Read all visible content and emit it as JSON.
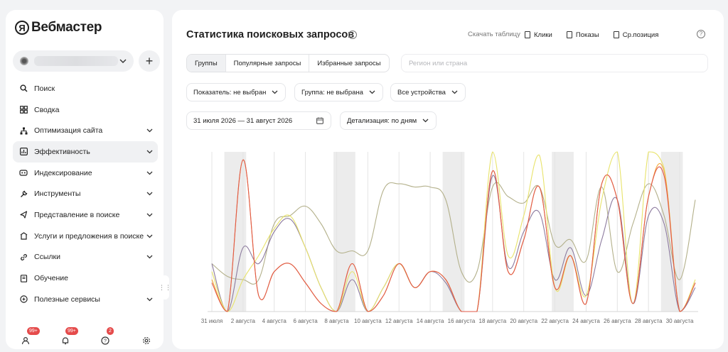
{
  "sidebar": {
    "logo_letter": "Я",
    "logo_text": "Вебмастер",
    "add_site_label": "+",
    "items": [
      {
        "label": "Поиск",
        "icon": "search-icon",
        "chevron": false,
        "active": false
      },
      {
        "label": "Сводка",
        "icon": "dashboard-icon",
        "chevron": false,
        "active": false
      },
      {
        "label": "Оптимизация сайта",
        "icon": "sitemap-icon",
        "chevron": true,
        "active": false
      },
      {
        "label": "Эффективность",
        "icon": "chart-icon",
        "chevron": true,
        "active": true
      },
      {
        "label": "Индексирование",
        "icon": "robot-icon",
        "chevron": true,
        "active": false
      },
      {
        "label": "Инструменты",
        "icon": "wrench-icon",
        "chevron": true,
        "active": false
      },
      {
        "label": "Представление в поиске",
        "icon": "present-icon",
        "chevron": true,
        "active": false
      },
      {
        "label": "Услуги и предложения в поиске",
        "icon": "services-icon",
        "chevron": true,
        "active": false
      },
      {
        "label": "Ссылки",
        "icon": "link-icon",
        "chevron": true,
        "active": false
      },
      {
        "label": "Обучение",
        "icon": "book-icon",
        "chevron": false,
        "active": false
      },
      {
        "label": "Полезные сервисы",
        "icon": "services-circle-icon",
        "chevron": true,
        "active": false
      }
    ],
    "footer": {
      "users_badge": "99+",
      "notifications_badge": "99+",
      "help_badge": "2"
    }
  },
  "header": {
    "title": "Статистика поисковых запросов",
    "download_label": "Скачать таблицу",
    "metric_tabs": [
      "Клики",
      "Показы",
      "Ср.позиция"
    ]
  },
  "segments": [
    "Группы",
    "Популярные запросы",
    "Избранные запросы"
  ],
  "region_placeholder": "Регион или страна",
  "filters": {
    "indicator": "Показатель: не выбран",
    "group": "Группа: не выбрана",
    "devices": "Все устройства",
    "date_range": "31 июля 2026 — 31 август 2026",
    "detail": "Детализация: по дням"
  },
  "colors": {
    "accent_red": "#e0584a",
    "orange": "#f4a93b",
    "yellow": "#e8e36a",
    "purple": "#8c7a9e",
    "olive": "#b3b08a",
    "weekend_band": "#ececec"
  },
  "chart_data": {
    "type": "line",
    "x": [
      "31 июля",
      "1 августа",
      "2 августа",
      "3 августа",
      "4 августа",
      "5 августа",
      "6 августа",
      "7 августа",
      "8 августа",
      "9 августа",
      "10 августа",
      "11 августа",
      "12 августа",
      "13 августа",
      "14 августа",
      "15 августа",
      "16 августа",
      "17 августа",
      "18 августа",
      "19 августа",
      "20 августа",
      "21 августа",
      "22 августа",
      "23 августа",
      "24 августа",
      "25 августа",
      "26 августа",
      "27 августа",
      "28 августа",
      "29 августа",
      "30 августа",
      "31 августа"
    ],
    "tick_labels": [
      "31 июля",
      "2 августа",
      "4 августа",
      "6 августа",
      "8 августа",
      "10 августа",
      "12 августа",
      "14 августа",
      "16 августа",
      "18 августа",
      "20 августа",
      "22 августа",
      "24 августа",
      "26 августа",
      "28 августа",
      "30 августа"
    ],
    "weekend_bands": [
      [
        "1 августа",
        "2 августа"
      ],
      [
        "8 августа",
        "9 августа"
      ],
      [
        "15 августа",
        "16 августа"
      ],
      [
        "22 августа",
        "23 августа"
      ],
      [
        "29 августа",
        "30 августа"
      ]
    ],
    "ylim": [
      0,
      1
    ],
    "grid": true,
    "legend": "none",
    "series": [
      {
        "color": "#b3b08a",
        "values": [
          0.3,
          0.22,
          0.2,
          0.2,
          0.55,
          0.6,
          0.66,
          0.55,
          0.38,
          0.38,
          0.38,
          0.76,
          0.8,
          0.78,
          0.78,
          0.7,
          0.25,
          0.25,
          0.78,
          0.72,
          0.68,
          0.78,
          0.42,
          0.45,
          0.32,
          0.78,
          0.25,
          0.55,
          0.8,
          0.6,
          0.2,
          0.7
        ]
      },
      {
        "color": "#8c7a9e",
        "values": [
          0.3,
          0.0,
          0.4,
          0.3,
          0.5,
          0.58,
          0.4,
          0.15,
          0.0,
          0.2,
          0.0,
          0.15,
          0.3,
          0.15,
          0.25,
          0.18,
          0.0,
          0.0,
          0.85,
          0.28,
          0.5,
          0.62,
          0.2,
          0.4,
          0.1,
          0.45,
          0.7,
          0.05,
          0.6,
          0.55,
          0.0,
          0.15
        ]
      },
      {
        "color": "#e8e36a",
        "values": [
          0.25,
          0.0,
          0.2,
          0.35,
          0.52,
          0.6,
          0.4,
          0.15,
          0.0,
          0.25,
          0.0,
          0.15,
          0.3,
          0.15,
          0.25,
          0.2,
          0.0,
          0.0,
          1.0,
          0.35,
          0.6,
          0.98,
          0.15,
          0.35,
          0.1,
          0.7,
          1.0,
          0.05,
          1.0,
          0.9,
          0.0,
          0.2
        ]
      },
      {
        "color": "#f4a93b",
        "values": [
          0.2,
          0.0,
          0.95,
          0.1,
          0.25,
          0.3,
          0.18,
          0.05,
          0.0,
          0.3,
          0.0,
          0.1,
          0.3,
          0.15,
          0.25,
          0.2,
          0.0,
          0.0,
          0.88,
          0.25,
          0.45,
          0.78,
          0.15,
          0.35,
          0.05,
          0.8,
          0.7,
          0.05,
          0.72,
          0.88,
          0.0,
          0.18
        ]
      },
      {
        "color": "#e0584a",
        "values": [
          0.18,
          0.0,
          0.95,
          0.1,
          0.25,
          0.3,
          0.18,
          0.05,
          0.0,
          0.3,
          0.0,
          0.1,
          0.3,
          0.15,
          0.25,
          0.2,
          0.0,
          0.0,
          0.88,
          0.25,
          0.45,
          0.78,
          0.15,
          0.35,
          0.05,
          0.8,
          0.7,
          0.05,
          0.72,
          0.85,
          0.0,
          0.18
        ]
      }
    ]
  }
}
